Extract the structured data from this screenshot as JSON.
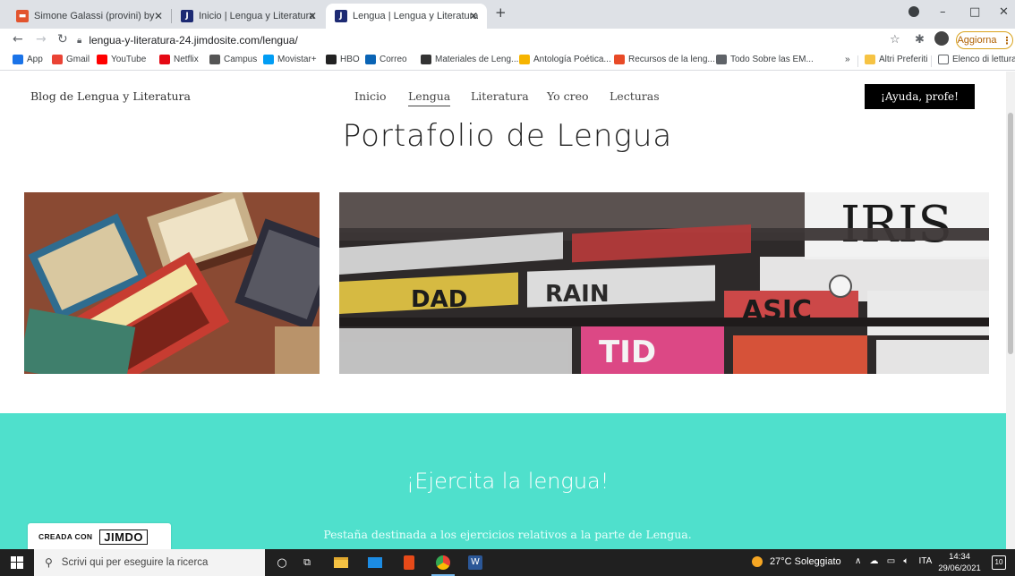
{
  "browser": {
    "tabs": [
      {
        "label": "Simone Galassi (provini) by Dotti",
        "active": false
      },
      {
        "label": "Inicio | Lengua y Literatura",
        "active": false
      },
      {
        "label": "Lengua | Lengua y Literatura",
        "active": true
      }
    ],
    "new_tab": "+",
    "window_controls": {
      "minimize": "–",
      "maximize": "□",
      "close": "✕"
    },
    "url": "lengua-y-literatura-24.jimdosite.com/lengua/",
    "update_label": "Aggiorna",
    "bookmarks": [
      {
        "label": "App",
        "icon": "apps-grid-icon",
        "color": "#1a73e8"
      },
      {
        "label": "Gmail",
        "icon": "gmail-icon",
        "color": "#ea4335"
      },
      {
        "label": "YouTube",
        "icon": "youtube-icon",
        "color": "#ff0000"
      },
      {
        "label": "Netflix",
        "icon": "netflix-icon",
        "color": "#e50914"
      },
      {
        "label": "Campus",
        "icon": "campus-icon",
        "color": "#555555"
      },
      {
        "label": "Movistar+",
        "icon": "movistar-icon",
        "color": "#019df4"
      },
      {
        "label": "HBO",
        "icon": "hbo-icon",
        "color": "#222222"
      },
      {
        "label": "Correo",
        "icon": "mail-icon",
        "color": "#0a64b5"
      },
      {
        "label": "Materiales de Leng...",
        "icon": "books-icon",
        "color": "#333333"
      },
      {
        "label": "Antología Poética...",
        "icon": "doc-icon",
        "color": "#f6b400"
      },
      {
        "label": "Recursos de la leng...",
        "icon": "recursos-icon",
        "color": "#e84a27"
      },
      {
        "label": "Todo Sobre las EM...",
        "icon": "globe-icon",
        "color": "#5f6368"
      }
    ],
    "bookmarks_overflow": "»",
    "other_bookmarks": "Altri Preferiti",
    "reading_list": "Elenco di lettura"
  },
  "site": {
    "name": "Blog de Lengua y Literatura",
    "menu": [
      "Inicio",
      "Lengua",
      "Literatura",
      "Yo creo",
      "Lecturas"
    ],
    "current_menu": "Lengua",
    "help_button": "¡Ayuda, profe!",
    "title": "Portafolio de Lengua",
    "section": {
      "title": "¡Ejercita la lengua!",
      "subtitle": "Pestaña destinada a los ejercicios relativos a la parte de Lengua."
    },
    "badge": {
      "made_with": "CREADA CON",
      "brand": "JIMDO"
    }
  },
  "taskbar": {
    "search_placeholder": "Scrivi qui per eseguire la ricerca",
    "weather": "27°C Soleggiato",
    "language": "ITA",
    "time": "14:34",
    "date": "29/06/2021",
    "notifications": "10"
  },
  "colors": {
    "teal": "#4fe0cc",
    "tab_strip": "#dee1e6",
    "help_button_bg": "#000000",
    "taskbar": "#202020"
  }
}
